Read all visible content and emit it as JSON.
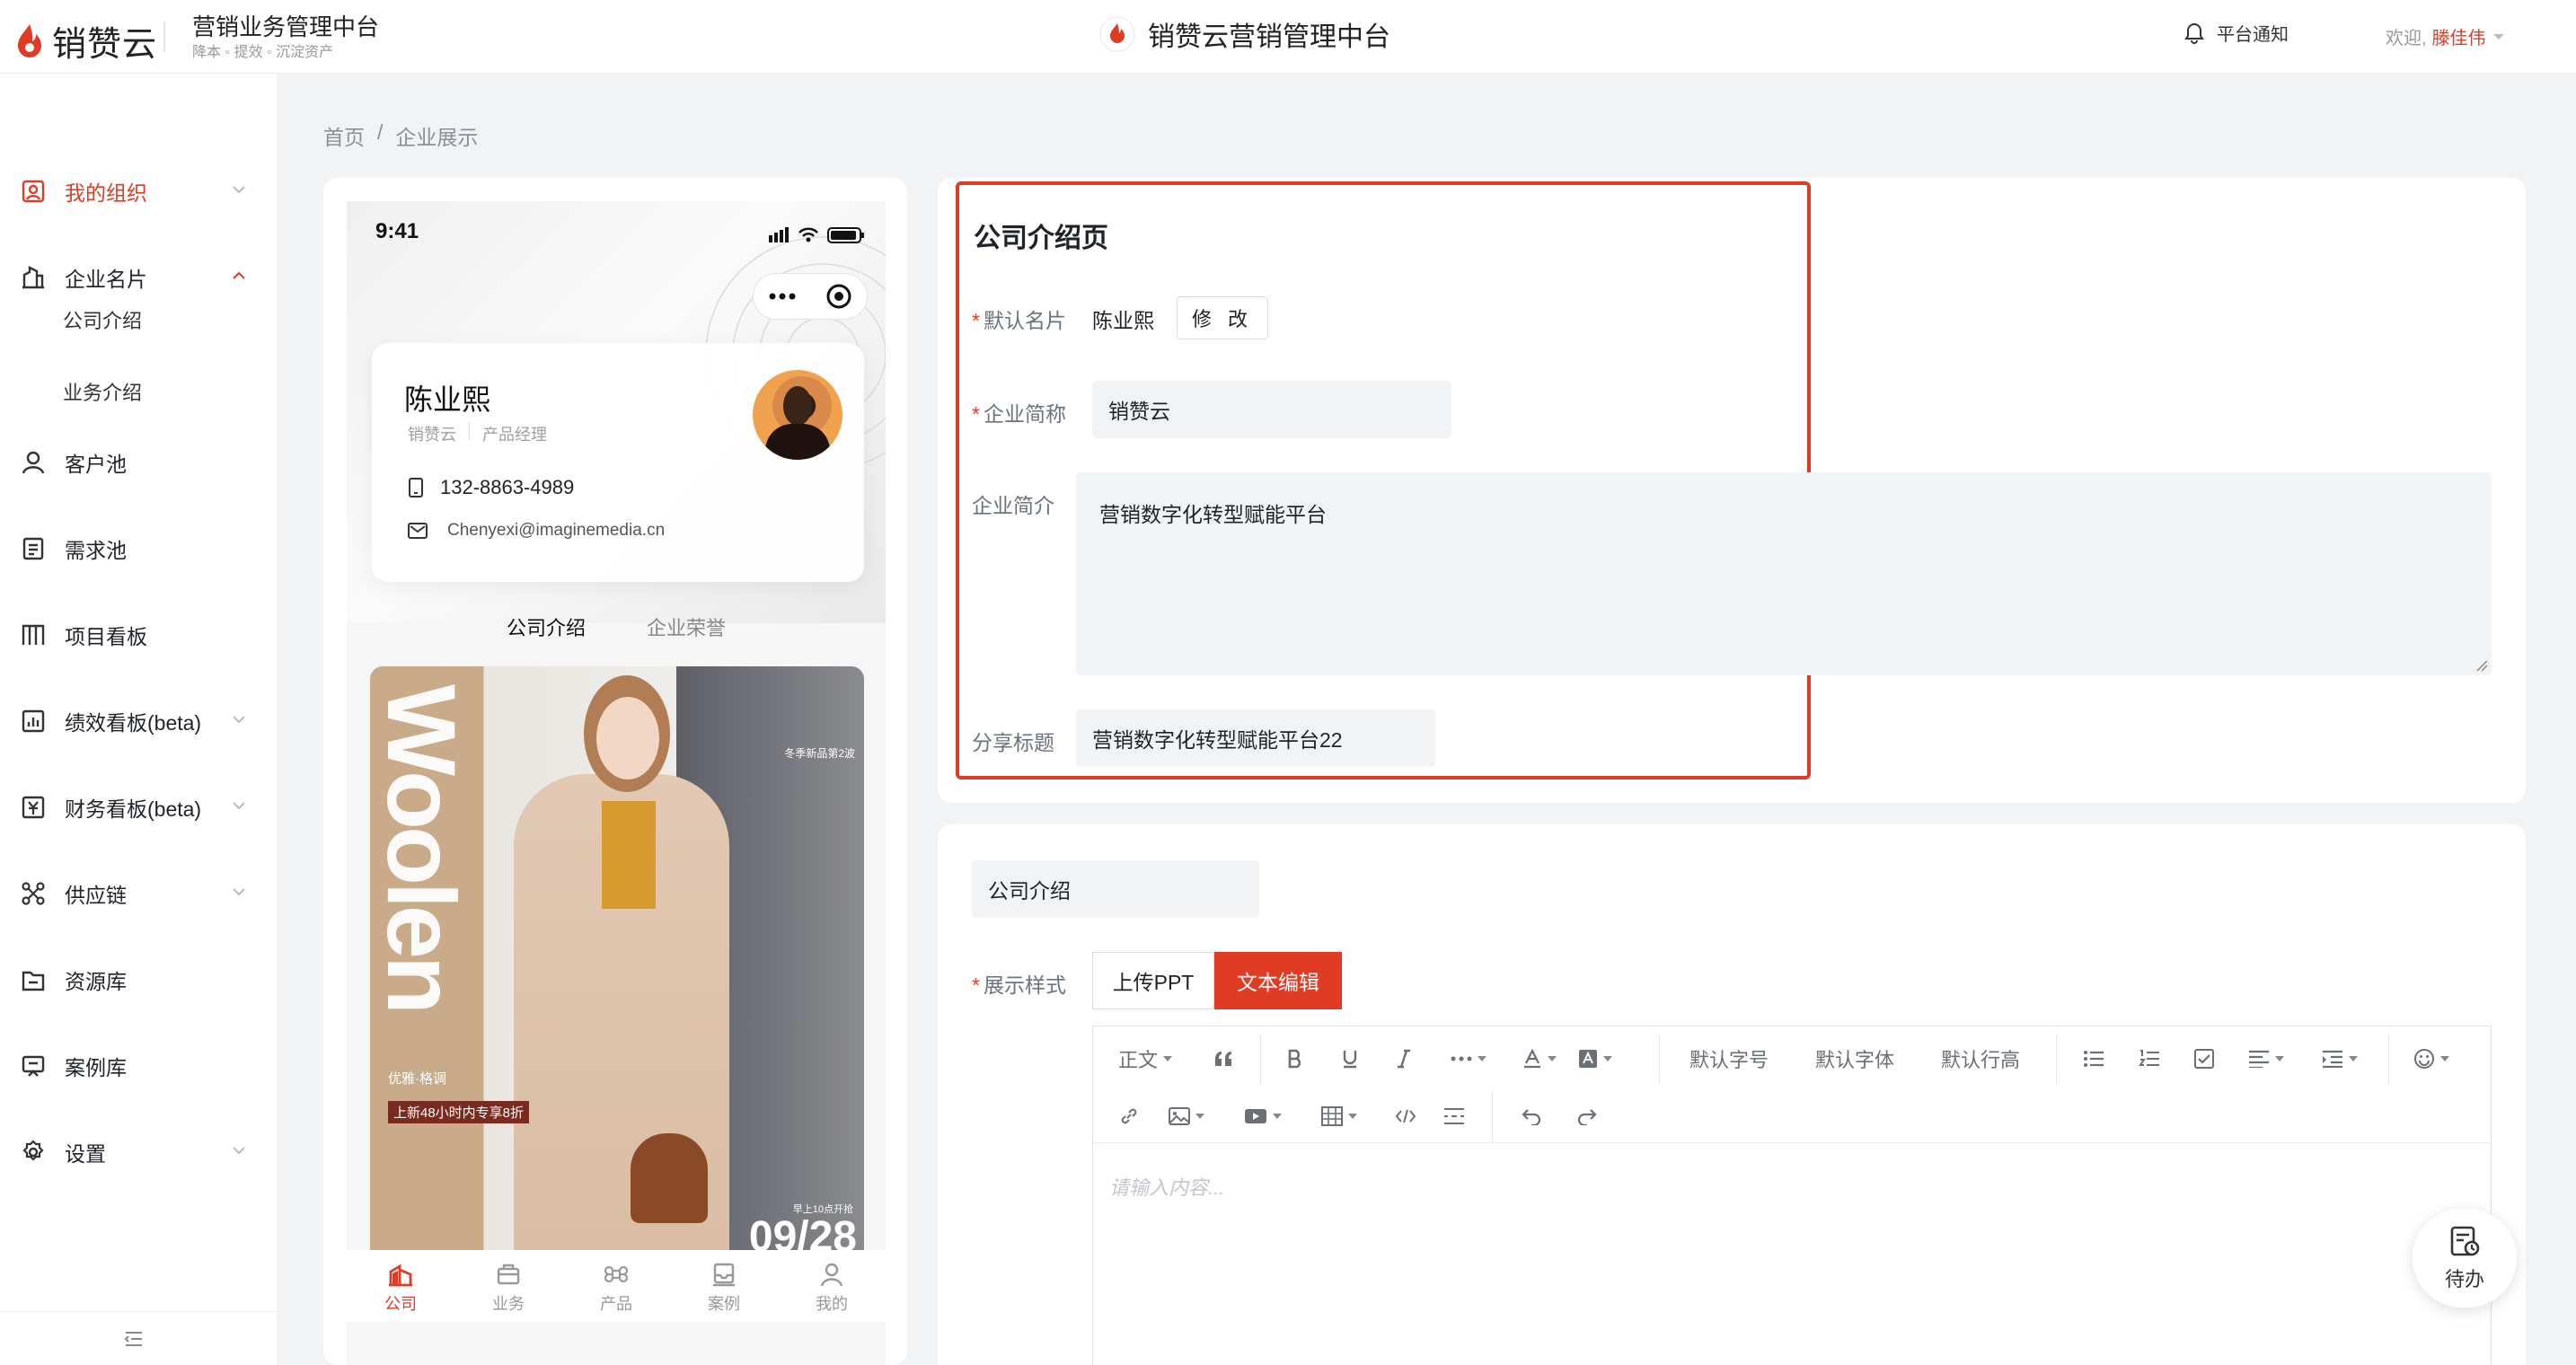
{
  "header": {
    "logo_text": "销赞云",
    "title": "营销业务管理中台",
    "subtitle": "降本 ◦ 提效 ◦ 沉淀资产",
    "center_title": "销赞云营销管理中台",
    "notice": "平台通知",
    "welcome": "欢迎,",
    "username": "滕佳伟"
  },
  "sidebar": {
    "items": [
      {
        "label": "我的组织",
        "icon": "org-icon",
        "active": true
      },
      {
        "label": "企业名片",
        "icon": "building-icon"
      },
      {
        "label": "客户池",
        "icon": "user-icon"
      },
      {
        "label": "需求池",
        "icon": "doc-icon"
      },
      {
        "label": "项目看板",
        "icon": "board-icon"
      },
      {
        "label": "绩效看板(beta)",
        "icon": "chart-icon"
      },
      {
        "label": "财务看板(beta)",
        "icon": "finance-icon"
      },
      {
        "label": "供应链",
        "icon": "network-icon"
      },
      {
        "label": "资源库",
        "icon": "folder-icon"
      },
      {
        "label": "案例库",
        "icon": "case-icon"
      },
      {
        "label": "设置",
        "icon": "gear-icon"
      }
    ],
    "sub_items": [
      "公司介绍",
      "业务介绍"
    ]
  },
  "breadcrumb": {
    "home": "首页",
    "sep": "/",
    "current": "企业展示"
  },
  "phone": {
    "time": "9:41",
    "name": "陈业熙",
    "company": "销赞云",
    "position": "产品经理",
    "phone": "132-8863-4989",
    "email": "Chenyexi@imaginemedia.cn",
    "tab_active": "公司介绍",
    "tab_other": "企业荣誉",
    "poster": {
      "word": "Woolen",
      "tag1": "优雅·格调",
      "tag2": "上新48小时内专享8折",
      "tag3": "冬季新品第2波",
      "tag4": "早上10点开抢",
      "date": "09/28"
    },
    "nav": [
      "公司",
      "业务",
      "产品",
      "案例",
      "我的"
    ]
  },
  "intro_page": {
    "title": "公司介绍页",
    "default_card_label": "默认名片",
    "default_card_value": "陈业熙",
    "edit_button": "修 改",
    "short_name_label": "企业简称",
    "short_name_value": "销赞云",
    "intro_label": "企业简介",
    "intro_value": "营销数字化转型赋能平台",
    "share_title_label": "分享标题",
    "share_title_value": "营销数字化转型赋能平台22"
  },
  "intro_section": {
    "title_value": "公司介绍",
    "style_label": "展示样式",
    "btn_ppt": "上传PPT",
    "btn_text": "文本编辑"
  },
  "editor": {
    "heading": "正文",
    "font_size": "默认字号",
    "font_family": "默认字体",
    "line_height": "默认行高",
    "placeholder": "请输入内容..."
  },
  "todo": {
    "label": "待办"
  },
  "colors": {
    "accent": "#e03b23",
    "bg": "#f2f3f5"
  }
}
